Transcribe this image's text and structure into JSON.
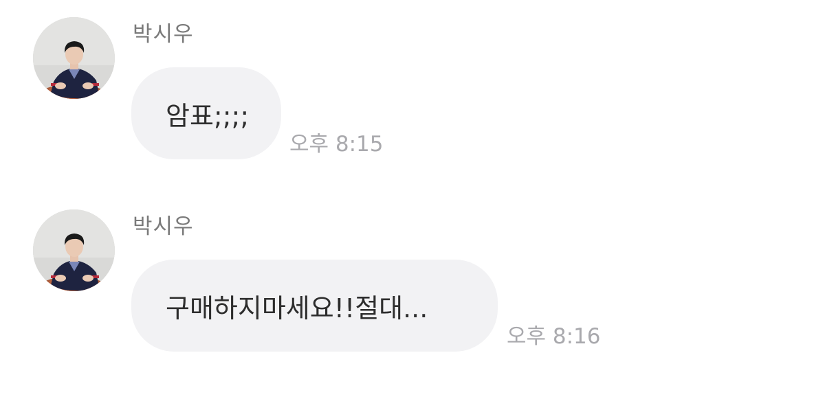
{
  "conversation": {
    "messages": [
      {
        "sender": "박시우",
        "avatar_icon": "profile-photo",
        "text": "암표;;;;",
        "time": "오후 8:15"
      },
      {
        "sender": "박시우",
        "avatar_icon": "profile-photo",
        "text": "구매하지마세요!!절대...",
        "time": "오후 8:16"
      }
    ]
  },
  "colors": {
    "bubble_bg": "#f2f2f4",
    "sender_text": "#7a7a7a",
    "time_text": "#a9a9ad",
    "message_text": "#2d2d2d"
  }
}
